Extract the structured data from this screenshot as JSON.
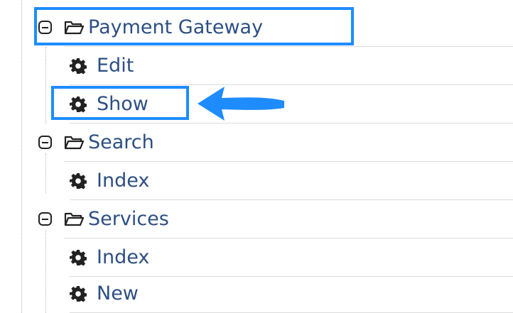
{
  "tree": {
    "items": [
      {
        "label": "Payment Gateway",
        "type": "folder",
        "expanded": true
      },
      {
        "label": "Edit",
        "type": "action"
      },
      {
        "label": "Show",
        "type": "action",
        "highlighted": true
      },
      {
        "label": "Search",
        "type": "folder",
        "expanded": true
      },
      {
        "label": "Index",
        "type": "action"
      },
      {
        "label": "Services",
        "type": "folder",
        "expanded": true
      },
      {
        "label": "Index",
        "type": "action"
      },
      {
        "label": "New",
        "type": "action"
      }
    ]
  },
  "colors": {
    "label": "#2d4f82",
    "highlight": "#1e8cff",
    "row_border": "#dcdcdc"
  },
  "icons": {
    "folder": "folder-icon",
    "action": "gear-icon",
    "toggle": "collapse-toggle-icon"
  }
}
